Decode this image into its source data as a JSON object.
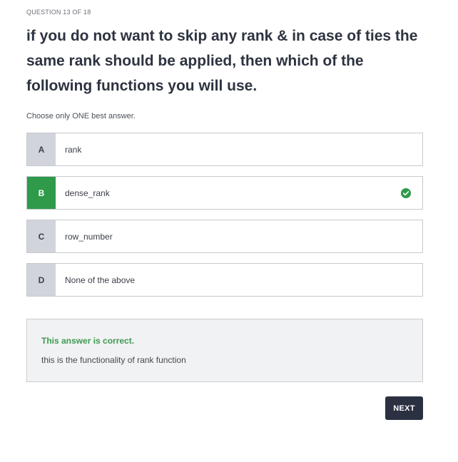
{
  "header": {
    "question_counter": "QUESTION 13 OF 18"
  },
  "question": {
    "text": "if you do not want to skip any rank & in case of ties the same rank should be applied, then which of the following functions you will use.",
    "instruction": "Choose only ONE best answer."
  },
  "options": [
    {
      "letter": "A",
      "label": "rank",
      "selected": false
    },
    {
      "letter": "B",
      "label": "dense_rank",
      "selected": true
    },
    {
      "letter": "C",
      "label": "row_number",
      "selected": false
    },
    {
      "letter": "D",
      "label": "None of the above",
      "selected": false
    }
  ],
  "feedback": {
    "title": "This answer is correct.",
    "explanation": "this is the functionality of rank function"
  },
  "actions": {
    "next_label": "NEXT"
  },
  "colors": {
    "selected": "#2e9a4a",
    "correct_text": "#3f9a52",
    "button_bg": "#2c3142"
  },
  "icons": {
    "correct": "check-circle-icon"
  }
}
